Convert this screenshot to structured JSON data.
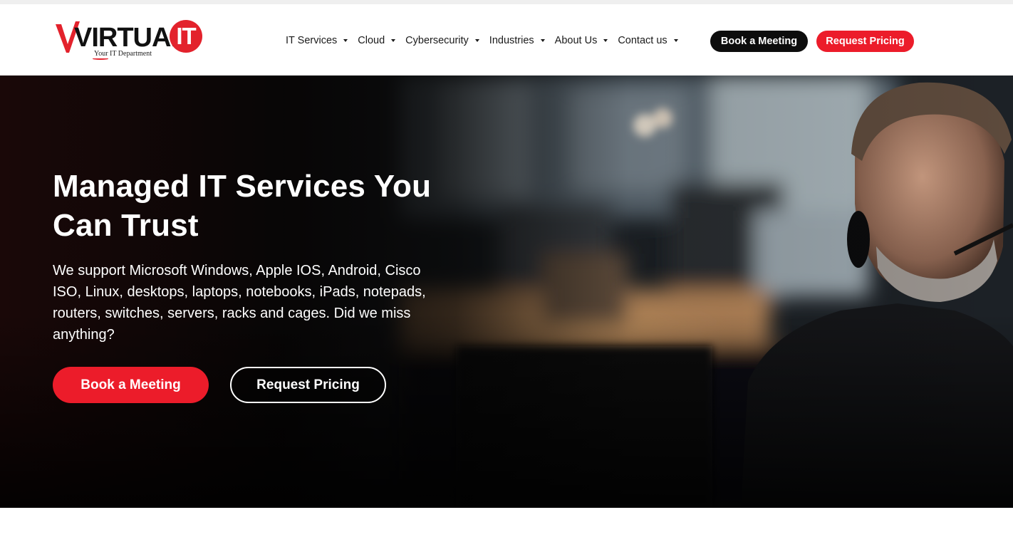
{
  "brand": {
    "name": "VIRTUAL",
    "name_suffix": "IT",
    "tagline": "Your IT Department",
    "accent_color": "#ec1c2a"
  },
  "nav": {
    "items": [
      {
        "label": "IT Services",
        "icon": "caret-down-icon"
      },
      {
        "label": "Cloud",
        "icon": "caret-down-icon"
      },
      {
        "label": "Cybersecurity",
        "icon": "caret-down-icon"
      },
      {
        "label": "Industries",
        "icon": "caret-down-icon"
      },
      {
        "label": "About Us",
        "icon": "caret-down-icon"
      },
      {
        "label": "Contact us",
        "icon": "caret-down-icon"
      }
    ],
    "book_meeting_label": "Book a Meeting",
    "request_pricing_label": "Request Pricing"
  },
  "hero": {
    "title": "Managed IT Services You Can Trust",
    "text": "We support Microsoft Windows, Apple IOS, Android, Cisco ISO, Linux, desktops, laptops, notebooks, iPads, notepads, routers, switches, servers, racks and cages.  Did we miss anything?",
    "primary_button": "Book a Meeting",
    "secondary_button": "Request Pricing"
  }
}
